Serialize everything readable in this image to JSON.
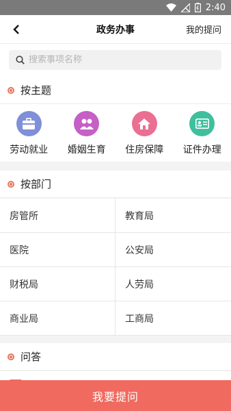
{
  "status_bar": {
    "time": "2:40"
  },
  "header": {
    "title": "政务办事",
    "my_questions": "我的提问"
  },
  "search": {
    "placeholder": "搜索事项名称",
    "value": ""
  },
  "sections": {
    "theme": "按主题",
    "department": "按部门",
    "qa": "问答"
  },
  "themes": [
    {
      "label": "劳动就业",
      "icon": "briefcase-icon",
      "color": "#7f8fd8"
    },
    {
      "label": "婚姻生育",
      "icon": "couple-icon",
      "color": "#c460c6"
    },
    {
      "label": "住房保障",
      "icon": "house-icon",
      "color": "#ea6f92"
    },
    {
      "label": "证件办理",
      "icon": "id-card-icon",
      "color": "#3fbf9e"
    }
  ],
  "departments": [
    [
      "房管所",
      "教育局"
    ],
    [
      "医院",
      "公安局"
    ],
    [
      "财税局",
      "人劳局"
    ],
    [
      "商业局",
      "工商局"
    ]
  ],
  "bottom_button": "我要提问",
  "colors": {
    "accent": "#f06a5f",
    "dot": "#e8735c"
  }
}
